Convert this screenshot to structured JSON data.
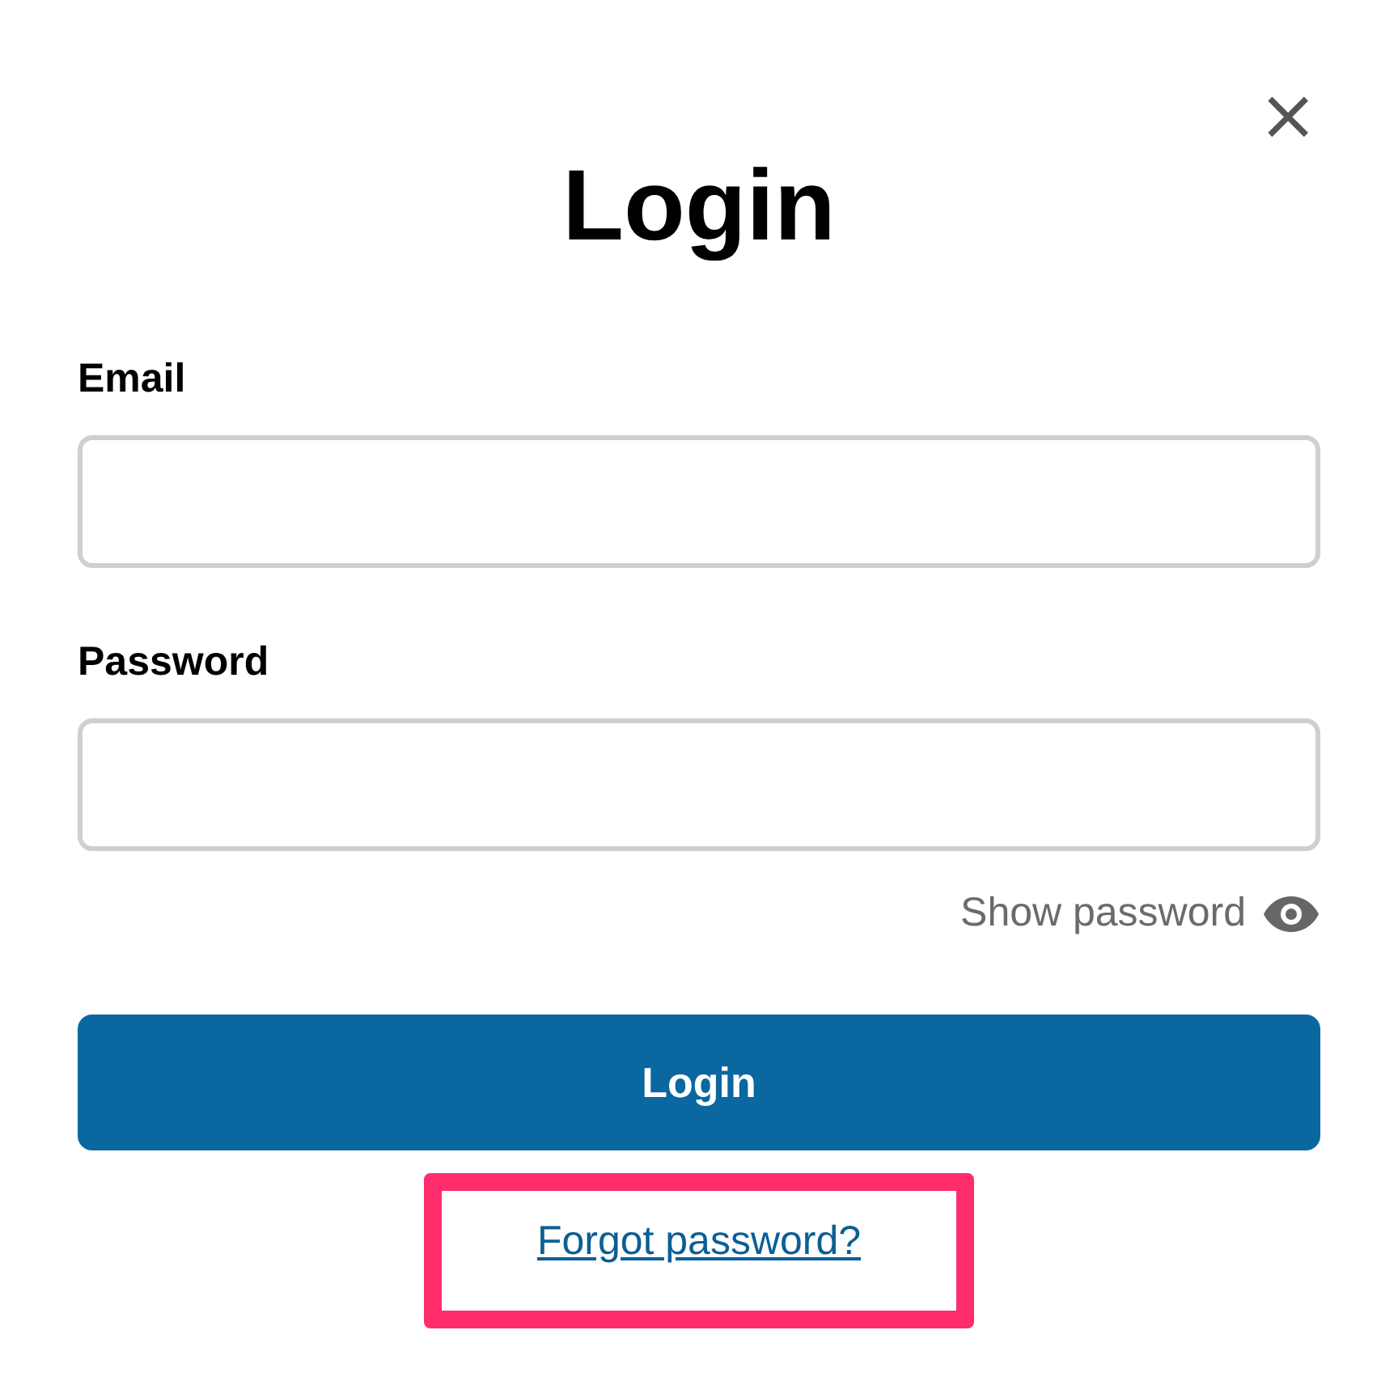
{
  "dialog": {
    "title": "Login",
    "close": "×"
  },
  "fields": [
    {
      "label": "Email"
    },
    {
      "label": "Password"
    }
  ],
  "show_password": {
    "label": "Show password",
    "checked": false
  },
  "submit": "Login",
  "forgot_link": {
    "label": "Forgot password?",
    "highlighted": true
  }
}
